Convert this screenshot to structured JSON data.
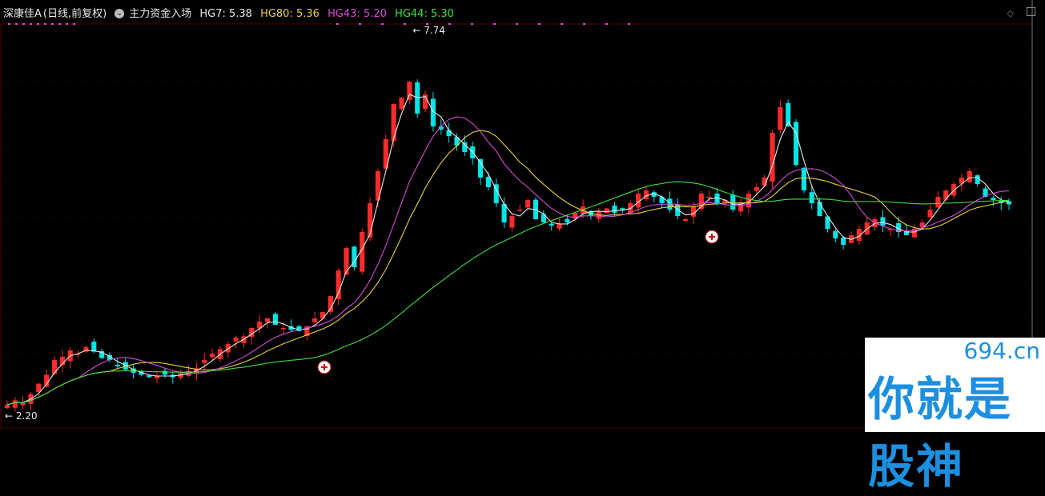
{
  "header": {
    "stock": "深康佳A",
    "period": "(日线,前复权)",
    "indicator_name": "主力资金入场",
    "hg7": "HG7: 5.38",
    "hg80": "HG80: 5.36",
    "hg43": "HG43: 5.20",
    "hg44": "HG44: 5.30"
  },
  "colors": {
    "up": "#ff2a2a",
    "down": "#00e5e5",
    "hg7": "#e8e8e8",
    "hg80": "#e8d23a",
    "hg43": "#d64cd6",
    "hg44": "#3ee03e",
    "grid": "#5a0000"
  },
  "watermark": {
    "url": "694.cn",
    "text": "你就是股神"
  },
  "chart_data": {
    "type": "candlestick",
    "high_label": "7.74",
    "low_label": "2.20",
    "ylim": [
      2.1,
      7.95
    ],
    "close": [
      2.25,
      2.32,
      2.28,
      2.42,
      2.58,
      2.72,
      2.95,
      3.0,
      3.1,
      3.05,
      3.15,
      3.08,
      2.98,
      2.95,
      2.85,
      2.8,
      2.75,
      2.72,
      2.68,
      2.7,
      2.72,
      2.68,
      2.75,
      2.78,
      2.82,
      2.95,
      3.05,
      3.12,
      3.2,
      3.3,
      3.32,
      3.45,
      3.55,
      3.6,
      3.5,
      3.45,
      3.42,
      3.4,
      3.48,
      3.6,
      3.7,
      3.95,
      4.35,
      4.7,
      4.4,
      4.95,
      5.4,
      5.9,
      6.4,
      6.95,
      7.05,
      7.3,
      6.8,
      7.1,
      6.6,
      6.55,
      6.45,
      6.3,
      6.2,
      6.1,
      5.8,
      5.65,
      5.4,
      5.1,
      5.2,
      5.3,
      5.45,
      5.15,
      5.1,
      5.05,
      5.08,
      5.1,
      5.25,
      5.35,
      5.2,
      5.28,
      5.32,
      5.25,
      5.3,
      5.4,
      5.55,
      5.6,
      5.5,
      5.4,
      5.3,
      5.2,
      5.15,
      5.35,
      5.55,
      5.5,
      5.4,
      5.45,
      5.3,
      5.4,
      5.55,
      5.65,
      5.8,
      6.5,
      6.9,
      6.6,
      6.0,
      5.6,
      5.4,
      5.2,
      5.0,
      4.85,
      4.75,
      4.9,
      5.0,
      5.1,
      5.15,
      5.05,
      5.0,
      4.95,
      4.9,
      5.0,
      5.1,
      5.3,
      5.5,
      5.6,
      5.7,
      5.8,
      5.9,
      5.7,
      5.5,
      5.45,
      5.4,
      5.38
    ]
  }
}
